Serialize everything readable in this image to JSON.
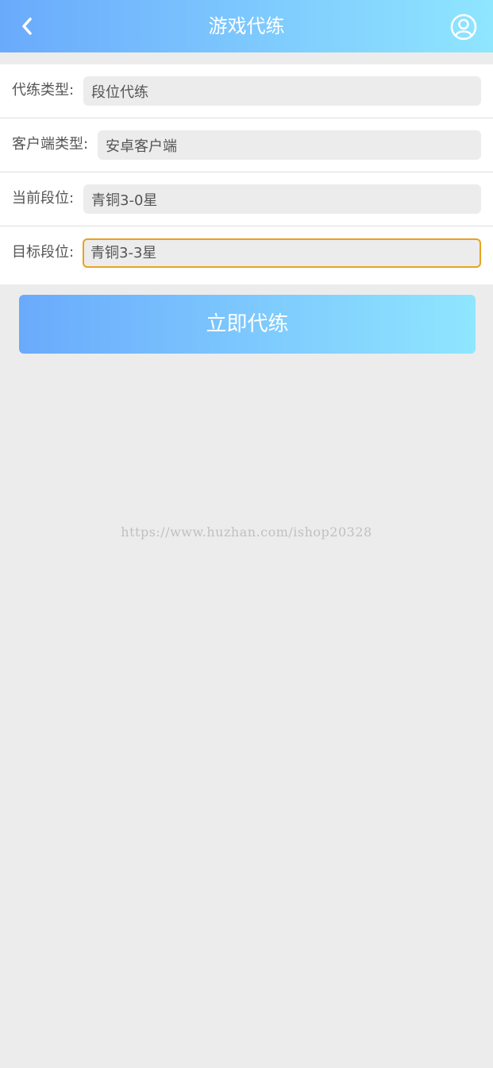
{
  "header": {
    "title": "游戏代练",
    "back_icon": "chevron-left-icon",
    "user_icon": "user-circle-icon"
  },
  "form": {
    "rows": [
      {
        "label": "代练类型:",
        "value": "段位代练"
      },
      {
        "label": "客户端类型:",
        "value": "安卓客户端"
      },
      {
        "label": "当前段位:",
        "value": "青铜3-0星"
      },
      {
        "label": "目标段位:",
        "value": "青铜3-3星"
      }
    ]
  },
  "submit": {
    "label": "立即代练"
  },
  "watermark": "https://www.huzhan.com/ishop20328",
  "colors": {
    "header_gradient_start": "#6aaafc",
    "header_gradient_end": "#8fe6ff",
    "focus_border": "#e8a21f",
    "background": "#ececec"
  }
}
